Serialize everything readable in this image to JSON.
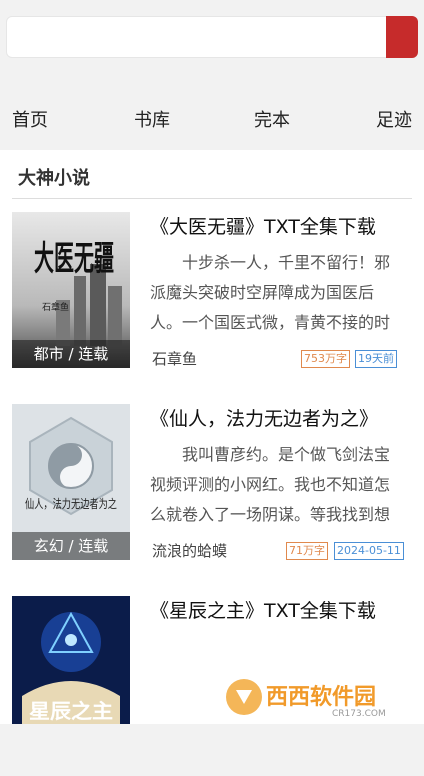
{
  "search": {
    "value": "",
    "placeholder": ""
  },
  "nav": {
    "items": [
      "首页",
      "书库",
      "完本",
      "足迹"
    ]
  },
  "section": {
    "title": "大神小说"
  },
  "books": [
    {
      "title": "《大医无疆》TXT全集下载",
      "description": "十步杀一人，千里不留行！邪派魔头突破时空屏障成为国医后人。一个国医式微，青黄不接的时",
      "author": "石章鱼",
      "genre": "都市 / 连载",
      "word_count": "753万字",
      "updated": "19天前",
      "cover_text": "大医无疆",
      "cover_author": "石章鱼"
    },
    {
      "title": "《仙人，法力无边者为之》",
      "description": "我叫曹彦约。是个做飞剑法宝视频评测的小网红。我也不知道怎么就卷入了一场阴谋。等我找到想",
      "author": "流浪的蛤蟆",
      "genre": "玄幻 / 连载",
      "word_count": "71万字",
      "updated": "2024-05-11",
      "cover_text": "仙人，法力无边者为之"
    },
    {
      "title": "《星辰之主》TXT全集下载",
      "cover_text": "星辰之主"
    }
  ],
  "watermark": {
    "text": "西西软件园",
    "url_text": "CR173.COM"
  },
  "colors": {
    "accent": "#c62b2b",
    "words_badge": "#e0894d",
    "date_badge": "#4a8fd6"
  }
}
